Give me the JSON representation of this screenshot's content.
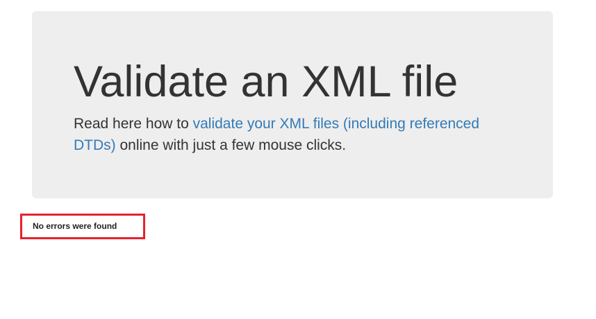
{
  "hero": {
    "title": "Validate an XML file",
    "lead_prefix": "Read here how to ",
    "lead_link": "validate your XML files (including referenced DTDs)",
    "lead_suffix": " online with just a few mouse clicks."
  },
  "result": {
    "message": "No errors were found"
  },
  "colors": {
    "jumbotron_bg": "#eeeeee",
    "link": "#337ab7",
    "result_border": "#e8202e",
    "text": "#333333"
  }
}
